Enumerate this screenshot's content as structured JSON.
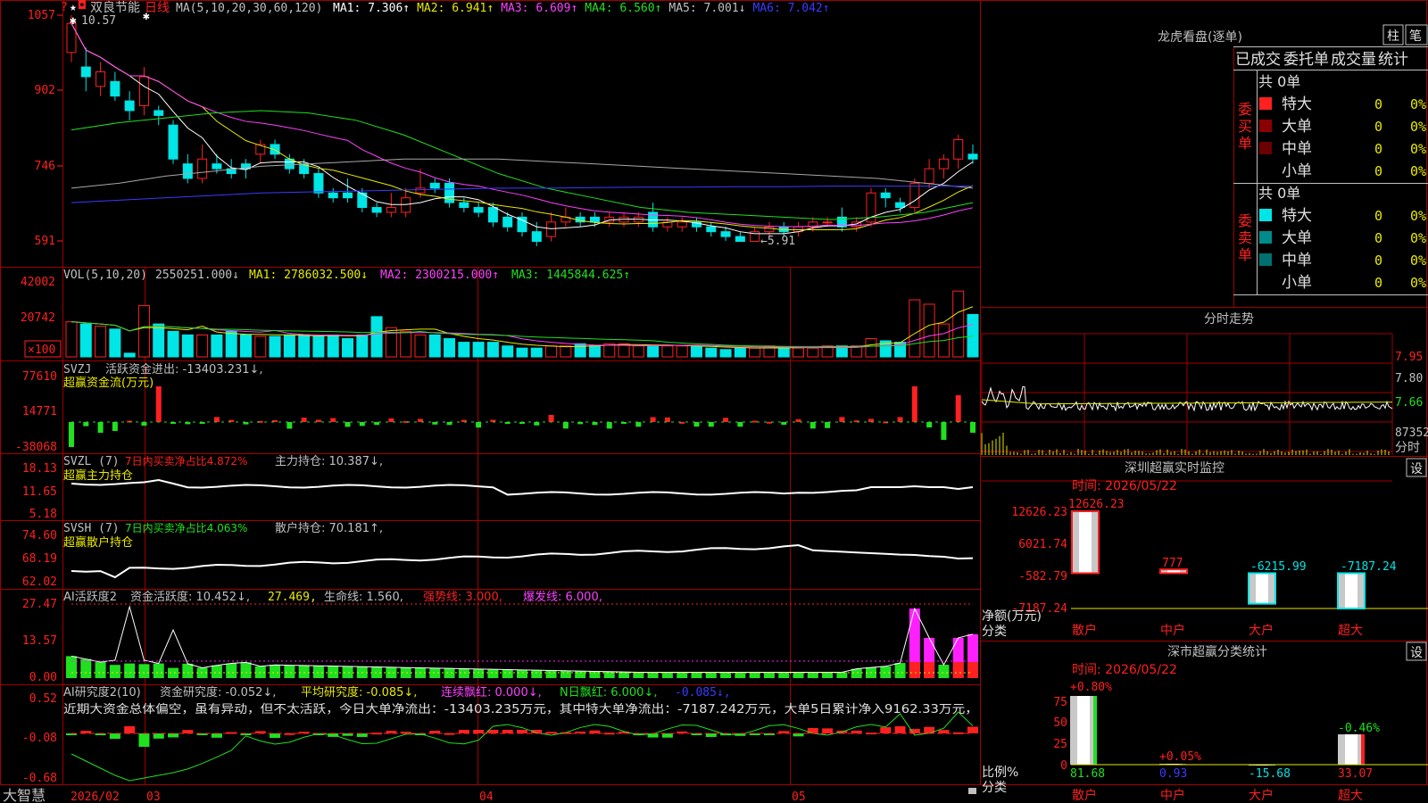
{
  "app": {
    "brand": "大智慧",
    "stock_name": "双良节能",
    "period": "日线",
    "date_labels": [
      "2026/02",
      "03",
      "04",
      "05"
    ]
  },
  "colors": {
    "up": "#ff2020",
    "down": "#00e5e5",
    "frame": "#a00000",
    "ma1": "#ffffff",
    "ma2": "#e8e800",
    "ma3": "#ff40ff",
    "ma4": "#20e020",
    "ma5": "#a8a8a8",
    "ma6": "#3a3aff"
  },
  "price_panel": {
    "ma_header_label": "MA(5,10,20,30,60,120)",
    "ma": [
      {
        "text": "MA1: 7.306↑",
        "color": "#ffffff"
      },
      {
        "text": "MA2: 6.941↑",
        "color": "#e8e800"
      },
      {
        "text": "MA3: 6.609↑",
        "color": "#ff40ff"
      },
      {
        "text": "MA4: 6.560↑",
        "color": "#20e020"
      },
      {
        "text": "MA5: 7.001↓",
        "color": "#c0c0c0"
      },
      {
        "text": "MA6: 7.042↑",
        "color": "#3a3aff"
      }
    ],
    "high_mark": "10.57",
    "low_mark": "←5.91",
    "y_ticks": [
      "1057",
      "902",
      "746",
      "591"
    ]
  },
  "chart_data": [
    {
      "type": "candlestick",
      "title": "日线",
      "ylim": [
        5.6,
        10.6
      ],
      "high_label": 10.57,
      "low_label": 5.91,
      "candles": [
        [
          9.8,
          10.4,
          10.57,
          9.6
        ],
        [
          9.5,
          9.3,
          9.9,
          9.0
        ],
        [
          9.1,
          9.4,
          9.6,
          8.9
        ],
        [
          9.2,
          8.9,
          9.4,
          8.8
        ],
        [
          8.8,
          8.6,
          9.0,
          8.4
        ],
        [
          8.7,
          9.3,
          9.5,
          8.5
        ],
        [
          8.6,
          8.5,
          8.7,
          8.3
        ],
        [
          8.3,
          7.6,
          8.4,
          7.5
        ],
        [
          7.5,
          7.2,
          7.7,
          7.1
        ],
        [
          7.2,
          7.6,
          7.9,
          7.1
        ],
        [
          7.5,
          7.4,
          7.7,
          7.3
        ],
        [
          7.4,
          7.3,
          7.6,
          7.2
        ],
        [
          7.5,
          7.4,
          7.6,
          7.2
        ],
        [
          7.7,
          7.9,
          8.0,
          7.5
        ],
        [
          7.9,
          7.7,
          8.0,
          7.6
        ],
        [
          7.6,
          7.4,
          7.7,
          7.3
        ],
        [
          7.5,
          7.3,
          7.6,
          7.2
        ],
        [
          7.3,
          6.9,
          7.4,
          6.8
        ],
        [
          6.9,
          6.8,
          7.0,
          6.7
        ],
        [
          6.9,
          6.8,
          7.2,
          6.7
        ],
        [
          6.9,
          6.6,
          7.0,
          6.5
        ],
        [
          6.6,
          6.5,
          6.7,
          6.4
        ],
        [
          6.5,
          6.6,
          6.9,
          6.4
        ],
        [
          6.5,
          6.8,
          7.0,
          6.4
        ],
        [
          6.9,
          7.0,
          7.4,
          6.8
        ],
        [
          7.1,
          7.0,
          7.2,
          6.9
        ],
        [
          7.1,
          6.7,
          7.2,
          6.6
        ],
        [
          6.7,
          6.6,
          6.8,
          6.5
        ],
        [
          6.6,
          6.5,
          6.7,
          6.4
        ],
        [
          6.6,
          6.3,
          6.7,
          6.2
        ],
        [
          6.4,
          6.2,
          6.5,
          6.1
        ],
        [
          6.4,
          6.1,
          6.5,
          6.0
        ],
        [
          6.1,
          5.9,
          6.3,
          5.8
        ],
        [
          6.0,
          6.3,
          6.5,
          5.9
        ],
        [
          6.3,
          6.4,
          6.6,
          6.2
        ],
        [
          6.4,
          6.3,
          6.5,
          6.2
        ],
        [
          6.4,
          6.3,
          6.5,
          6.2
        ],
        [
          6.3,
          6.4,
          6.5,
          6.2
        ],
        [
          6.3,
          6.4,
          6.5,
          6.2
        ],
        [
          6.3,
          6.4,
          6.5,
          6.2
        ],
        [
          6.5,
          6.2,
          6.7,
          6.1
        ],
        [
          6.2,
          6.3,
          6.4,
          6.1
        ],
        [
          6.2,
          6.3,
          6.4,
          6.1
        ],
        [
          6.3,
          6.2,
          6.4,
          6.1
        ],
        [
          6.2,
          6.1,
          6.3,
          6.0
        ],
        [
          6.1,
          6.0,
          6.2,
          5.91
        ],
        [
          6.0,
          5.9,
          6.1,
          5.91
        ],
        [
          5.9,
          6.1,
          6.2,
          5.91
        ],
        [
          6.1,
          6.2,
          6.3,
          6.0
        ],
        [
          6.2,
          6.1,
          6.3,
          6.0
        ],
        [
          6.1,
          6.2,
          6.3,
          6.0
        ],
        [
          6.2,
          6.3,
          6.4,
          6.1
        ],
        [
          6.3,
          6.3,
          6.4,
          6.2
        ],
        [
          6.4,
          6.2,
          6.6,
          6.1
        ],
        [
          6.2,
          6.3,
          6.4,
          6.1
        ],
        [
          6.3,
          6.9,
          7.0,
          6.2
        ],
        [
          6.9,
          6.8,
          7.0,
          6.6
        ],
        [
          6.7,
          6.6,
          6.8,
          6.5
        ],
        [
          6.6,
          7.1,
          7.2,
          6.5
        ],
        [
          7.1,
          7.4,
          7.6,
          7.0
        ],
        [
          7.4,
          7.6,
          7.7,
          7.2
        ],
        [
          7.6,
          8.0,
          8.1,
          7.4
        ],
        [
          7.7,
          7.6,
          7.9,
          7.5
        ]
      ]
    },
    {
      "type": "bar",
      "title": "VOL(5,10,20)",
      "vol_value": 2550251,
      "ma": [
        2786032.5,
        2300215.0,
        1445844.625
      ],
      "unit": "×100",
      "ylim": [
        0,
        42002
      ],
      "ticks": [
        42002,
        20742
      ]
    },
    {
      "type": "bar",
      "title": "SVZJ 活跃资金进出",
      "subtitle": "超赢资金流(万元)",
      "value": -13403.231,
      "ylim": [
        -38068,
        77610
      ],
      "ticks": [
        77610,
        14771,
        -38068
      ]
    },
    {
      "type": "line",
      "title": "SVZL (7)",
      "subtitle": "超赢主力持仓",
      "net_ratio": 4.872,
      "position": 10.387,
      "ylim": [
        5.18,
        18.13
      ],
      "ticks": [
        18.13,
        11.65,
        5.18
      ]
    },
    {
      "type": "line",
      "title": "SVSH (7)",
      "subtitle": "超赢散户持仓",
      "net_ratio": 4.063,
      "position": 70.181,
      "ylim": [
        62.02,
        74.6
      ],
      "ticks": [
        74.6,
        68.19,
        62.02
      ]
    },
    {
      "type": "bar",
      "title": "AI活跃度2",
      "values": {
        "资金活跃度": 10.452,
        "second": 27.469,
        "生命线": 1.56,
        "强势线": 3.0,
        "爆发线": 6.0
      },
      "ylim": [
        0,
        27.47
      ],
      "ticks": [
        27.47,
        13.57,
        0.0
      ]
    },
    {
      "type": "bar",
      "title": "AI研究度2(10)",
      "values": {
        "资金研究度": -0.052,
        "平均研究度": -0.085,
        "连续飘红": 0.0,
        "N日飘红": 6.0,
        "last": -0.085
      },
      "ylim": [
        -0.68,
        0.52
      ],
      "ticks": [
        0.52,
        -0.08,
        -0.68
      ]
    },
    {
      "type": "line",
      "title": "分时走势",
      "ylim": [
        7.56,
        8.0
      ],
      "ticks": [
        7.95,
        7.8,
        7.66
      ],
      "vol_label": "87352"
    },
    {
      "type": "bar",
      "title": "深圳超赢实时监控",
      "date": "时间: 2026/05/22",
      "categories": [
        "散户",
        "中户",
        "大户",
        "超大"
      ],
      "values": [
        12626.23,
        777,
        -6215.99,
        -7187.24
      ],
      "ylim": [
        -7187.24,
        12626.23
      ],
      "ticks": [
        "12626.23",
        "6021.74",
        "-582.79",
        "-7187.24"
      ],
      "ylabel": "净额(万元)",
      "xlabel": "分类"
    },
    {
      "type": "bar",
      "title": "深市超赢分类统计",
      "date": "时间: 2026/05/22",
      "categories": [
        "散户",
        "中户",
        "大户",
        "超大"
      ],
      "values": [
        81.68,
        0.93,
        -15.68,
        33.07
      ],
      "changes": [
        "+0.80%",
        "+0.05%",
        "",
        "-0.46%"
      ],
      "ylim": [
        0,
        75
      ],
      "ticks": [
        "75",
        "50",
        "25",
        "0"
      ],
      "ylabel": "比例%",
      "xlabel": "分类"
    }
  ],
  "panels": {
    "vol": {
      "label": "VOL(5,10,20)",
      "value": "2550251.000↓",
      "ma1": "MA1: 2786032.500↓",
      "ma2": "MA2: 2300215.000↑",
      "ma3": "MA3: 1445844.625↑",
      "ticks": [
        "42002",
        "20742"
      ],
      "unit": "×100"
    },
    "svzj": {
      "label": "SVZJ",
      "text": "活跃资金进出: -13403.231↓,",
      "subtitle": "超赢资金流(万元)",
      "ticks": [
        "77610",
        "14771",
        "-38068"
      ]
    },
    "svzl": {
      "label": "SVZL (7)",
      "ratio": "7日内买卖净占比4.872%",
      "hold": "主力持仓: 10.387↓,",
      "subtitle": "超赢主力持仓",
      "ticks": [
        "18.13",
        "11.65",
        "5.18"
      ]
    },
    "svsh": {
      "label": "SVSH (7)",
      "ratio": "7日内买卖净占比4.063%",
      "hold": "散户持仓: 70.181↑,",
      "subtitle": "超赢散户持仓",
      "ticks": [
        "74.60",
        "68.19",
        "62.02"
      ]
    },
    "ai1": {
      "label": "AI活跃度2",
      "v1": "资金活跃度: 10.452↓,",
      "v2": "27.469,",
      "v3": "生命线: 1.560,",
      "v4": "强势线: 3.000,",
      "v5": "爆发线: 6.000,",
      "ticks": [
        "27.47",
        "13.57",
        "0.00"
      ]
    },
    "ai2": {
      "label": "AI研究度2(10)",
      "v1": "资金研究度: -0.052↓,",
      "v2": "平均研究度: -0.085↓,",
      "v3": "连续飘红: 0.000↓,",
      "v4": "N日飘红: 6.000↓,",
      "v5": "-0.085↓,",
      "comment": "近期大资金总体偏空，虽有异动，但不太活跃，今日大单净流出：-13403.235万元，其中特大单净流出：-7187.242万元，大单5日累计净入9162.33万元，",
      "ticks": [
        "0.52",
        "-0.08",
        "-0.68"
      ]
    }
  },
  "right": {
    "lhb_title": "龙虎看盘(逐单)",
    "tab_zhu": "柱",
    "tab_bi": "笔",
    "tabs": [
      "已成交",
      "委托单",
      "成交量",
      "统计"
    ],
    "buy_label": "委买单",
    "sell_label": "委卖单",
    "buy_total": "共 0单",
    "sell_total": "共 0单",
    "buy_rows": [
      {
        "name": "特大",
        "count": "0",
        "pct": "0%"
      },
      {
        "name": "大单",
        "count": "0",
        "pct": "0%"
      },
      {
        "name": "中单",
        "count": "0",
        "pct": "0%"
      },
      {
        "name": "小单",
        "count": "0",
        "pct": "0%"
      }
    ],
    "sell_rows": [
      {
        "name": "特大",
        "count": "0",
        "pct": "0%"
      },
      {
        "name": "大单",
        "count": "0",
        "pct": "0%"
      },
      {
        "name": "中单",
        "count": "0",
        "pct": "0%"
      },
      {
        "name": "小单",
        "count": "0",
        "pct": "0%"
      }
    ],
    "fenshi_title": "分时走势",
    "fenshi_ticks": [
      "7.95",
      "7.80",
      "7.66"
    ],
    "fenshi_vol": "87352",
    "fenshi_unit": "分时",
    "sz_title": "深圳超赢实时监控",
    "sz_date": "时间: 2026/05/22",
    "sz_value_labels": [
      "12626.23",
      "777",
      "-6215.99",
      "-7187.24"
    ],
    "sz_ticks": [
      "12626.23",
      "6021.74",
      "-582.79",
      "-7187.24"
    ],
    "sz_ylabel": "净额(万元)",
    "sz_xlabel": "分类",
    "sz_cats": [
      "散户",
      "中户",
      "大户",
      "超大"
    ],
    "ss_title": "深市超赢分类统计",
    "ss_date": "时间: 2026/05/22",
    "ss_changes": [
      "+0.80%",
      "+0.05%",
      "-0.46%"
    ],
    "ss_values": [
      "81.68",
      "0.93",
      "-15.68",
      "33.07"
    ],
    "ss_ticks": [
      "75",
      "50",
      "25",
      "0"
    ],
    "ss_ylabel": "比例%",
    "ss_xlabel": "分类",
    "ss_cats": [
      "散户",
      "中户",
      "大户",
      "超大"
    ],
    "set_label": "设"
  }
}
